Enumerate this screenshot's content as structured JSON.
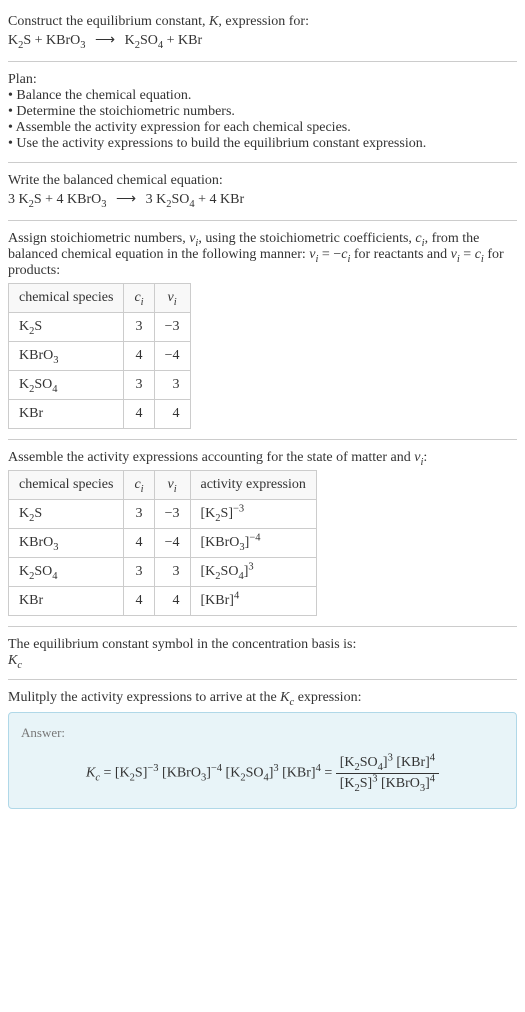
{
  "intro": {
    "line1": "Construct the equilibrium constant, ",
    "K": "K",
    "line1_end": ", expression for:",
    "eq_lhs_1": "K",
    "eq_lhs_1_sub": "2",
    "eq_lhs_1_end": "S + KBrO",
    "eq_lhs_1_sub2": "3",
    "arrow": "⟶",
    "eq_rhs_1": "K",
    "eq_rhs_1_sub": "2",
    "eq_rhs_1_mid": "SO",
    "eq_rhs_1_sub2": "4",
    "eq_rhs_1_end": " + KBr"
  },
  "plan": {
    "title": "Plan:",
    "items": [
      "Balance the chemical equation.",
      "Determine the stoichiometric numbers.",
      "Assemble the activity expression for each chemical species.",
      "Use the activity expressions to build the equilibrium constant expression."
    ]
  },
  "balanced": {
    "title": "Write the balanced chemical equation:",
    "c1": "3 K",
    "c1_sub": "2",
    "c1_end": "S + 4 KBrO",
    "c1_sub2": "3",
    "arrow": "⟶",
    "c2": "3 K",
    "c2_sub": "2",
    "c2_mid": "SO",
    "c2_sub2": "4",
    "c2_end": " + 4 KBr"
  },
  "stoich": {
    "intro1": "Assign stoichiometric numbers, ",
    "nu": "ν",
    "nu_sub": "i",
    "intro2": ", using the stoichiometric coefficients, ",
    "c": "c",
    "c_sub": "i",
    "intro3": ", from the balanced chemical equation in the following manner: ",
    "rel1_lhs": "ν",
    "rel1_lhs_sub": "i",
    "rel1_eq": " = −",
    "rel1_rhs": "c",
    "rel1_rhs_sub": "i",
    "rel_mid": " for reactants and ",
    "rel2_lhs": "ν",
    "rel2_lhs_sub": "i",
    "rel2_eq": " = ",
    "rel2_rhs": "c",
    "rel2_rhs_sub": "i",
    "rel_end": " for products:",
    "headers": {
      "species": "chemical species",
      "ci": "c",
      "ci_sub": "i",
      "nui": "ν",
      "nui_sub": "i"
    },
    "rows": [
      {
        "sp1": "K",
        "sp1_sub": "2",
        "sp1_end": "S",
        "ci": "3",
        "nui": "−3"
      },
      {
        "sp1": "KBrO",
        "sp1_sub": "3",
        "sp1_end": "",
        "ci": "4",
        "nui": "−4"
      },
      {
        "sp1": "K",
        "sp1_sub": "2",
        "sp1_mid": "SO",
        "sp1_sub2": "4",
        "sp1_end": "",
        "ci": "3",
        "nui": "3"
      },
      {
        "sp1": "KBr",
        "sp1_sub": "",
        "sp1_end": "",
        "ci": "4",
        "nui": "4"
      }
    ]
  },
  "activity": {
    "intro1": "Assemble the activity expressions accounting for the state of matter and ",
    "nu": "ν",
    "nu_sub": "i",
    "intro_end": ":",
    "headers": {
      "species": "chemical species",
      "ci": "c",
      "ci_sub": "i",
      "nui": "ν",
      "nui_sub": "i",
      "act": "activity expression"
    },
    "rows": [
      {
        "sp": "K",
        "sp_sub": "2",
        "sp_end": "S",
        "ci": "3",
        "nui": "−3",
        "act_b": "[K",
        "act_sub": "2",
        "act_e": "S]",
        "act_sup": "−3"
      },
      {
        "sp": "KBrO",
        "sp_sub": "3",
        "sp_end": "",
        "ci": "4",
        "nui": "−4",
        "act_b": "[KBrO",
        "act_sub": "3",
        "act_e": "]",
        "act_sup": "−4"
      },
      {
        "sp": "K",
        "sp_sub": "2",
        "sp_mid": "SO",
        "sp_sub2": "4",
        "sp_end": "",
        "ci": "3",
        "nui": "3",
        "act_b": "[K",
        "act_sub": "2",
        "act_mid": "SO",
        "act_sub2": "4",
        "act_e": "]",
        "act_sup": "3"
      },
      {
        "sp": "KBr",
        "sp_sub": "",
        "sp_end": "",
        "ci": "4",
        "nui": "4",
        "act_b": "[KBr]",
        "act_sub": "",
        "act_e": "",
        "act_sup": "4"
      }
    ]
  },
  "symbol": {
    "line": "The equilibrium constant symbol in the concentration basis is:",
    "Kc": "K",
    "Kc_sub": "c"
  },
  "final": {
    "intro1": "Mulitply the activity expressions to arrive at the ",
    "Kc": "K",
    "Kc_sub": "c",
    "intro_end": " expression:",
    "answer_label": "Answer:",
    "kc_pref": "K",
    "kc_pref_sub": "c",
    "eq": " = ",
    "t1": "[K",
    "t1_sub": "2",
    "t1_e": "S]",
    "t1_sup": "−3",
    "t2": " [KBrO",
    "t2_sub": "3",
    "t2_e": "]",
    "t2_sup": "−4",
    "t3": " [K",
    "t3_sub": "2",
    "t3_mid": "SO",
    "t3_sub2": "4",
    "t3_e": "]",
    "t3_sup": "3",
    "t4": " [KBr]",
    "t4_sup": "4",
    "eq2": " = ",
    "num_t1": "[K",
    "num_t1_sub": "2",
    "num_t1_mid": "SO",
    "num_t1_sub2": "4",
    "num_t1_e": "]",
    "num_t1_sup": "3",
    "num_t2": " [KBr]",
    "num_t2_sup": "4",
    "den_t1": "[K",
    "den_t1_sub": "2",
    "den_t1_e": "S]",
    "den_t1_sup": "3",
    "den_t2": " [KBrO",
    "den_t2_sub": "3",
    "den_t2_e": "]",
    "den_t2_sup": "4"
  }
}
